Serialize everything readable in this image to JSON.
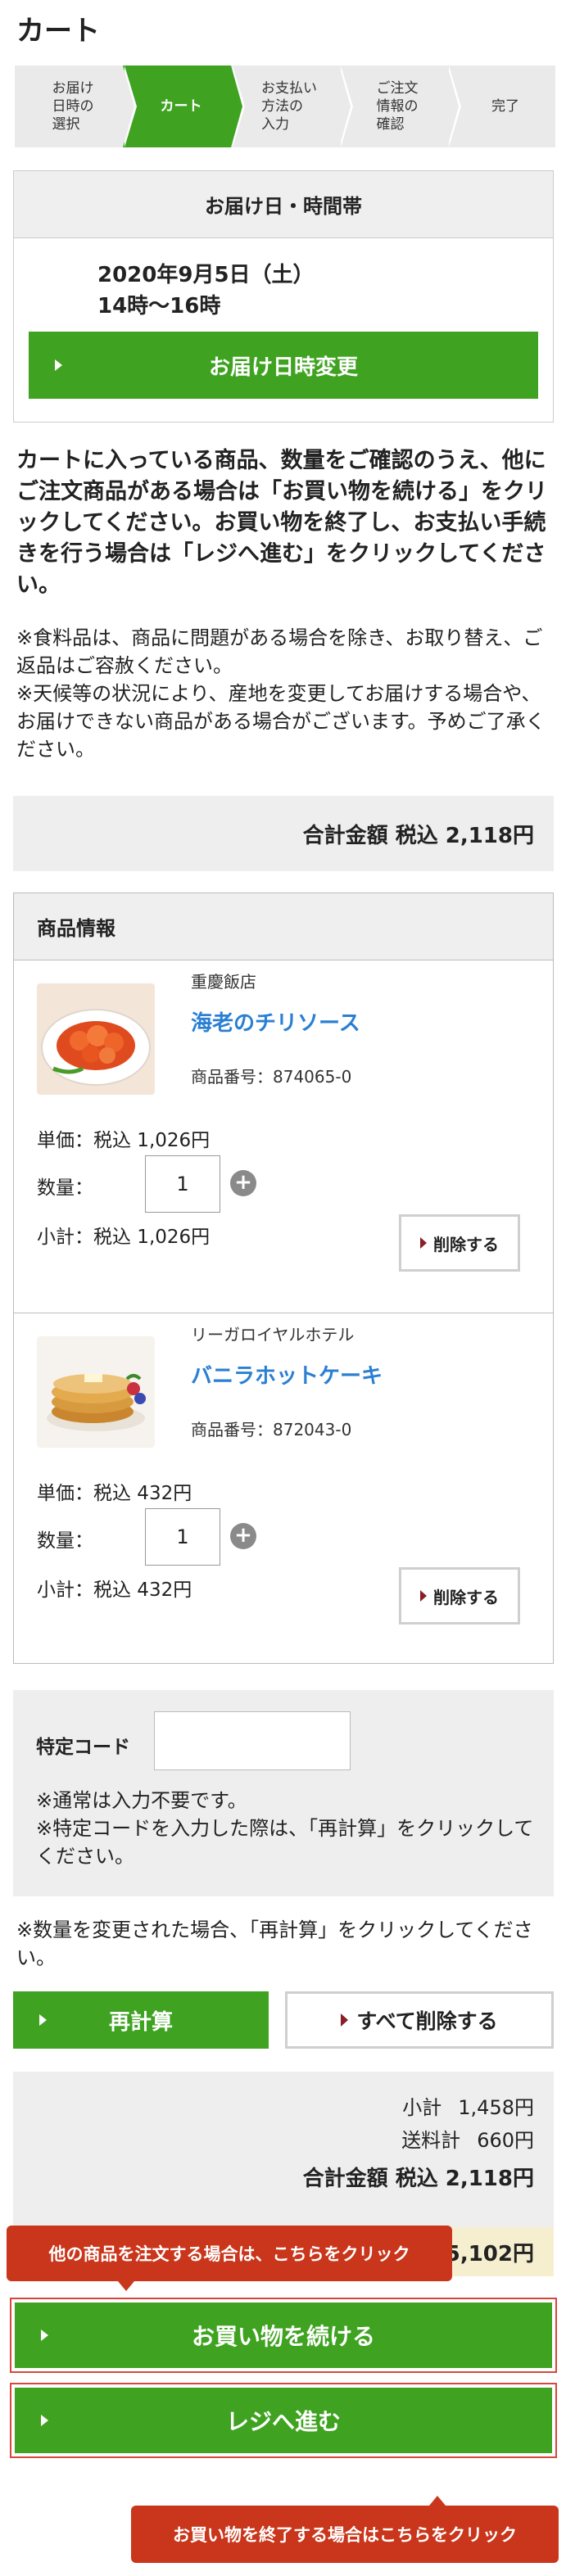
{
  "page": {
    "title": "カート"
  },
  "steps": [
    {
      "label": "お届け\n日時の\n選択",
      "active": false
    },
    {
      "label": "カート",
      "active": true
    },
    {
      "label": "お支払い\n方法の\n入力",
      "active": false
    },
    {
      "label": "ご注文\n情報の\n確認",
      "active": false
    },
    {
      "label": "完了",
      "active": false
    }
  ],
  "delivery": {
    "header": "お届け日・時間帯",
    "date": "2020年9月5日（土）",
    "time": "14時～16時",
    "change_button": "お届け日時変更"
  },
  "notice": {
    "main": "カートに入っている商品、数量をご確認のうえ、他にご注文商品がある場合は「お買い物を続ける」をクリックしてください。お買い物を終了し、お支払い手続きを行う場合は「レジへ進む」をクリックしてください。",
    "food": "※食料品は、商品に問題がある場合を除き、お取り替え、ご返品はご容赦ください。",
    "weather": "※天候等の状況により、産地を変更してお届けする場合や、お届けできない商品がある場合がございます。予めご了承ください。"
  },
  "total_bar": {
    "label": "合計金額 税込 2,118円"
  },
  "products": {
    "header": "商品情報",
    "items": [
      {
        "maker": "重慶飯店",
        "name": "海老のチリソース",
        "code": "商品番号：874065-0",
        "unit_price": "単価：税込 1,026円",
        "qty_label": "数量：",
        "qty": "1",
        "subtotal": "小計：税込 1,026円",
        "delete_label": "削除する"
      },
      {
        "maker": "リーガロイヤルホテル",
        "name": "バニラホットケーキ",
        "code": "商品番号：872043-0",
        "unit_price": "単価：税込 432円",
        "qty_label": "数量：",
        "qty": "1",
        "subtotal": "小計：税込 432円",
        "delete_label": "削除する"
      }
    ]
  },
  "special_code": {
    "label": "特定コード",
    "value": "",
    "note1": "※通常は入力不要です。",
    "note2": "※特定コードを入力した際は、「再計算」をクリックしてください。"
  },
  "recalc": {
    "note": "※数量を変更された場合、「再計算」をクリックしてください。",
    "recalc_button": "再計算",
    "clear_button": "すべて削除する"
  },
  "summary": {
    "subtotal_label": "小計",
    "subtotal_value": "1,458円",
    "shipping_label": "送料計",
    "shipping_value": "660円",
    "total": "合計金額 税込 2,118円",
    "strip_value": "5,102円"
  },
  "tooltips": {
    "continue_tip": "他の商品を注文する場合は、こちらをクリック",
    "checkout_tip": "お買い物を終了する場合はこちらをクリック"
  },
  "actions": {
    "continue_button": "お買い物を続ける",
    "checkout_button": "レジへ進む"
  },
  "colors": {
    "primary_green": "#3fa321",
    "link_blue": "#2a7fd3",
    "tooltip_red": "#c9361b",
    "panel_gray": "#eeeeee"
  }
}
